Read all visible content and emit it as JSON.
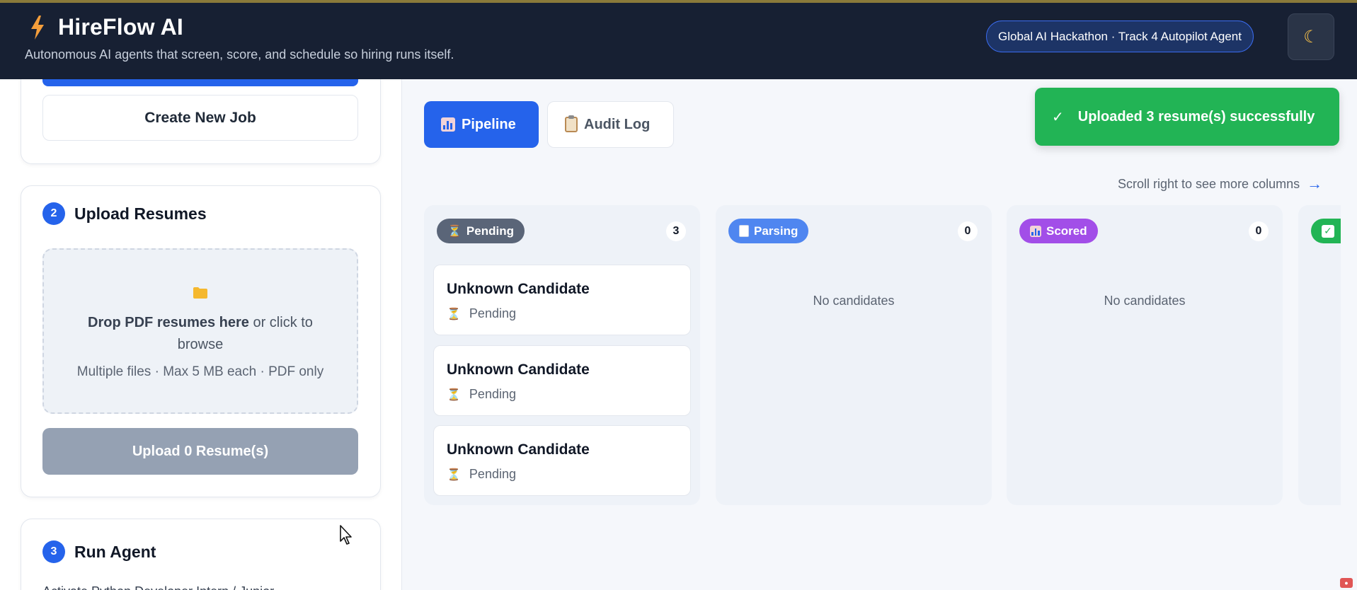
{
  "header": {
    "title": "HireFlow AI",
    "subtitle": "Autonomous AI agents that screen, score, and schedule so hiring runs itself.",
    "hackathon_pill": "Global AI Hackathon · Track 4 Autopilot Agent",
    "theme_toggle_icon": "moon-icon"
  },
  "sidebar": {
    "create_job_label": "Create New Job",
    "upload_section": {
      "step": "2",
      "title": "Upload Resumes",
      "dropzone_bold": "Drop PDF resumes here",
      "dropzone_rest": " or click to browse",
      "dropzone_hint": "Multiple files · Max 5 MB each · PDF only",
      "upload_button": "Upload 0 Resume(s)"
    },
    "run_section": {
      "step": "3",
      "title": "Run Agent",
      "description": "Activate Python Developer Intern / Junior..."
    }
  },
  "main": {
    "tabs": [
      {
        "label": "Pipeline",
        "icon": "bar-chart-icon",
        "active": true
      },
      {
        "label": "Audit Log",
        "icon": "clipboard-icon",
        "active": false
      }
    ],
    "scroll_hint": "Scroll right to see more columns",
    "columns": [
      {
        "label": "Pending",
        "count": "3",
        "color": "#5a6578",
        "empty_text": "",
        "cards": [
          {
            "name": "Unknown Candidate",
            "status": "Pending"
          },
          {
            "name": "Unknown Candidate",
            "status": "Pending"
          },
          {
            "name": "Unknown Candidate",
            "status": "Pending"
          }
        ]
      },
      {
        "label": "Parsing",
        "count": "0",
        "color": "#4f86f0",
        "empty_text": "No candidates",
        "cards": []
      },
      {
        "label": "Scored",
        "count": "0",
        "color": "#a24ee8",
        "empty_text": "No candidates",
        "cards": []
      }
    ]
  },
  "toast": {
    "message": "Uploaded 3 resume(s) successfully"
  },
  "colors": {
    "header_bg": "#172033",
    "primary": "#2563eb",
    "success": "#22b455",
    "muted_button": "#95a1b3"
  }
}
